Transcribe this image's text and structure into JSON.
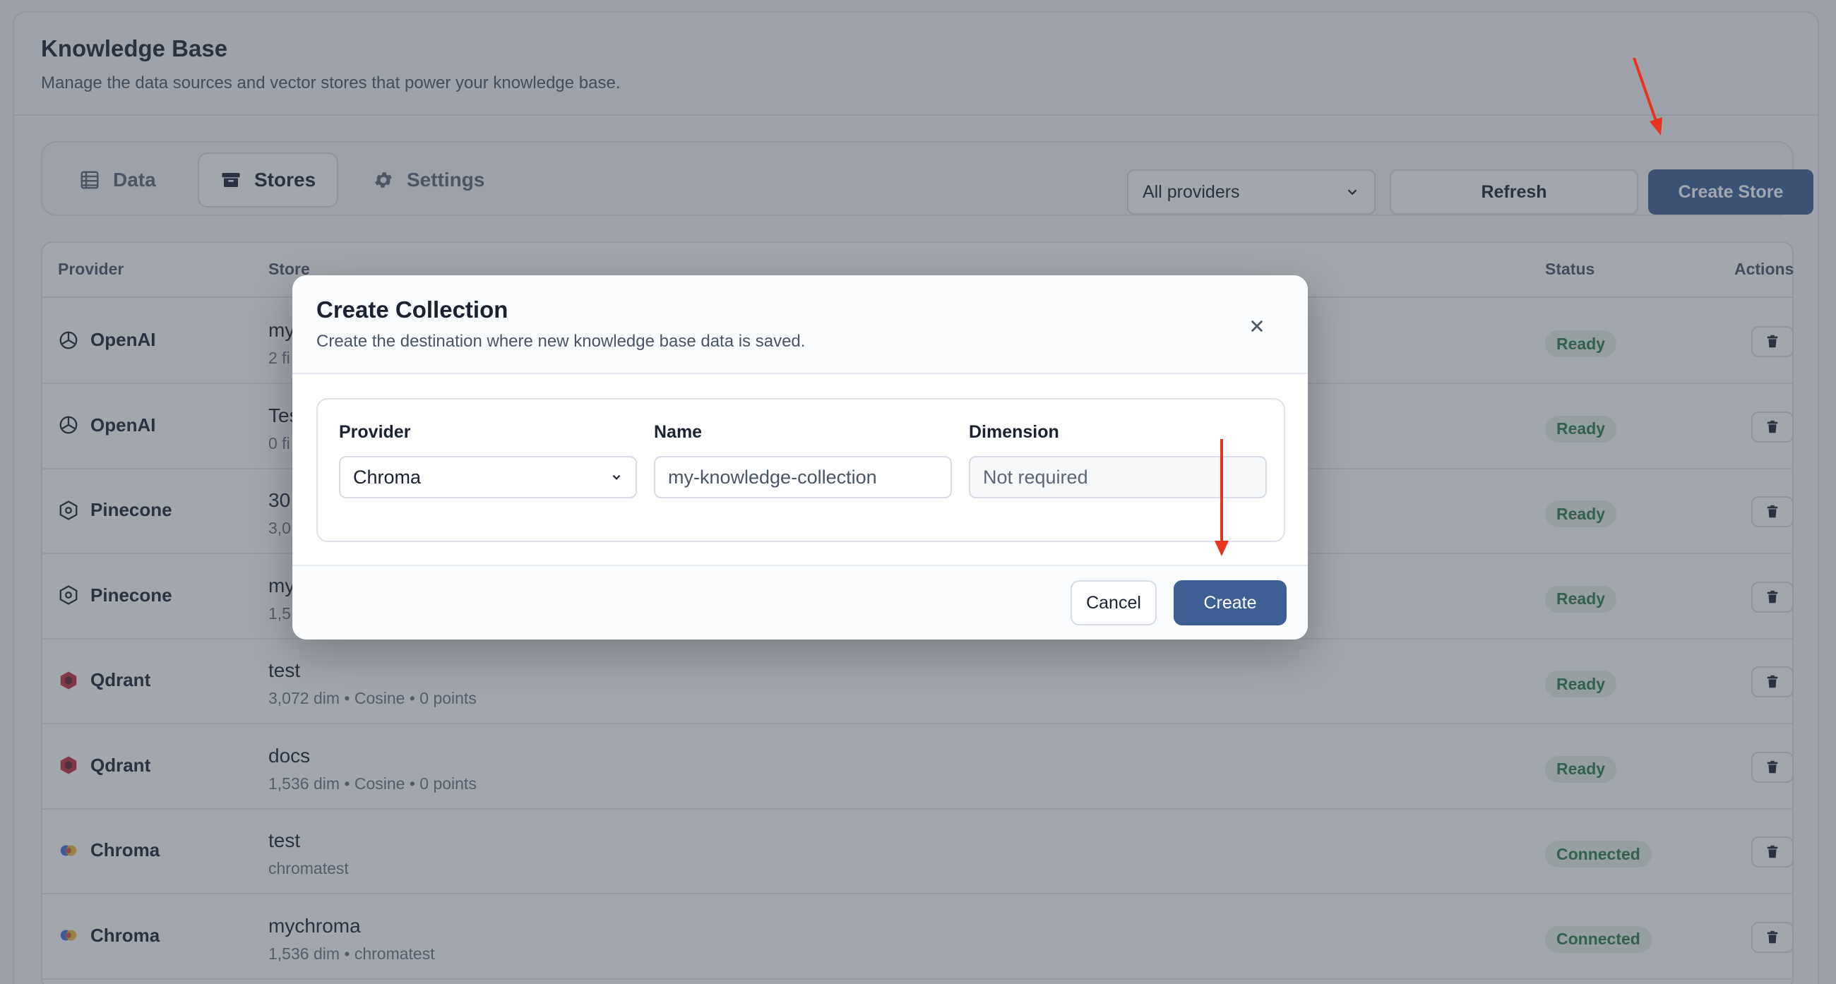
{
  "header": {
    "title": "Knowledge Base",
    "subtitle": "Manage the data sources and vector stores that power your knowledge base."
  },
  "tabs": [
    {
      "label": "Data",
      "icon": "table-icon",
      "active": false
    },
    {
      "label": "Stores",
      "icon": "archive-icon",
      "active": true
    },
    {
      "label": "Settings",
      "icon": "gear-icon",
      "active": false
    }
  ],
  "toolbar": {
    "provider_filter": "All providers",
    "refresh_label": "Refresh",
    "create_store_label": "Create Store"
  },
  "table": {
    "columns": [
      "Provider",
      "Store",
      "Status",
      "Actions"
    ],
    "rows": [
      {
        "provider": "OpenAI",
        "icon": "openai-icon",
        "store": "my",
        "meta": "2 fi",
        "status": "Ready"
      },
      {
        "provider": "OpenAI",
        "icon": "openai-icon",
        "store": "Tes",
        "meta": "0 fi",
        "status": "Ready"
      },
      {
        "provider": "Pinecone",
        "icon": "pinecone-icon",
        "store": "30",
        "meta": "3,0",
        "status": "Ready"
      },
      {
        "provider": "Pinecone",
        "icon": "pinecone-icon",
        "store": "my",
        "meta": "1,5",
        "status": "Ready"
      },
      {
        "provider": "Qdrant",
        "icon": "qdrant-icon",
        "store": "test",
        "meta": "3,072 dim  •  Cosine  •  0 points",
        "status": "Ready"
      },
      {
        "provider": "Qdrant",
        "icon": "qdrant-icon",
        "store": "docs",
        "meta": "1,536 dim  •  Cosine  •  0 points",
        "status": "Ready"
      },
      {
        "provider": "Chroma",
        "icon": "chroma-icon",
        "store": "test",
        "meta": "chromatest",
        "status": "Connected"
      },
      {
        "provider": "Chroma",
        "icon": "chroma-icon",
        "store": "mychroma",
        "meta": "1,536 dim  •  chromatest",
        "status": "Connected"
      }
    ]
  },
  "modal": {
    "title": "Create Collection",
    "subtitle": "Create the destination where new knowledge base data is saved.",
    "provider_label": "Provider",
    "provider_value": "Chroma",
    "name_label": "Name",
    "name_value": "my-knowledge-collection",
    "dimension_label": "Dimension",
    "dimension_placeholder": "Not required",
    "cancel_label": "Cancel",
    "create_label": "Create"
  },
  "colors": {
    "primary": "#3d5f93",
    "annotation_arrow": "#e8331e",
    "status_bg": "#e6f2ea",
    "status_text": "#2f7a4a"
  }
}
